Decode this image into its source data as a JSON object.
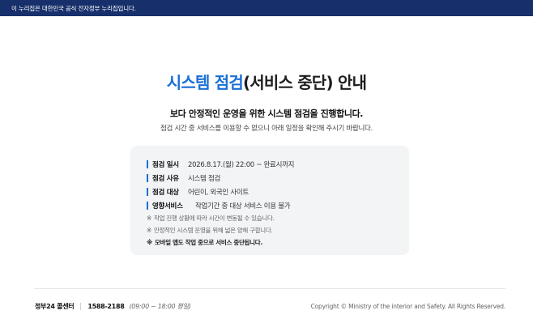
{
  "banner": {
    "text": "이 누리집은 대한민국 공식 전자정부 누리집입니다."
  },
  "notice": {
    "title_accent": "시스템 점검",
    "title_rest": "(서비스 중단) 안내",
    "subtitle": "보다 안정적인 운영을 위한 시스템 점검을 진행합니다.",
    "description": "점검 시간 중 서비스를 이용할 수 없으니 아래 일정을 확인해 주시기 바랍니다."
  },
  "details": [
    {
      "label": "점검 일시",
      "value": "2026.8.17.(월) 22:00 ~ 완료시까지"
    },
    {
      "label": "점검 사유",
      "value": "시스템 점검"
    },
    {
      "label": "점검 대상",
      "value": "어린이, 외국인 사이트"
    },
    {
      "label": "영향서비스",
      "value": "작업기간 중 대상 서비스 이용 불가"
    }
  ],
  "notes": [
    {
      "mark": "※",
      "text": "작업 진행 상황에 따라 시간이 변동될 수 있습니다."
    },
    {
      "mark": "※",
      "text": "안정적인 시스템 운영을 위해 넓은 양해 구합니다."
    },
    {
      "mark": "※",
      "text": "모바일 앱도 작업 중으로 서비스 중단됩니다."
    }
  ],
  "footer": {
    "call_center_name": "정부24 콜센터",
    "call_center_phone": "1588-2188",
    "call_center_hours": "(09:00 ~ 18:00 평일)",
    "copyright": "Copyright © Ministry of the interior and Safety. All Rights Reserved."
  },
  "colors": {
    "banner_bg": "#17306b",
    "accent": "#1a6fd6",
    "box_bg": "#f3f4f6"
  }
}
